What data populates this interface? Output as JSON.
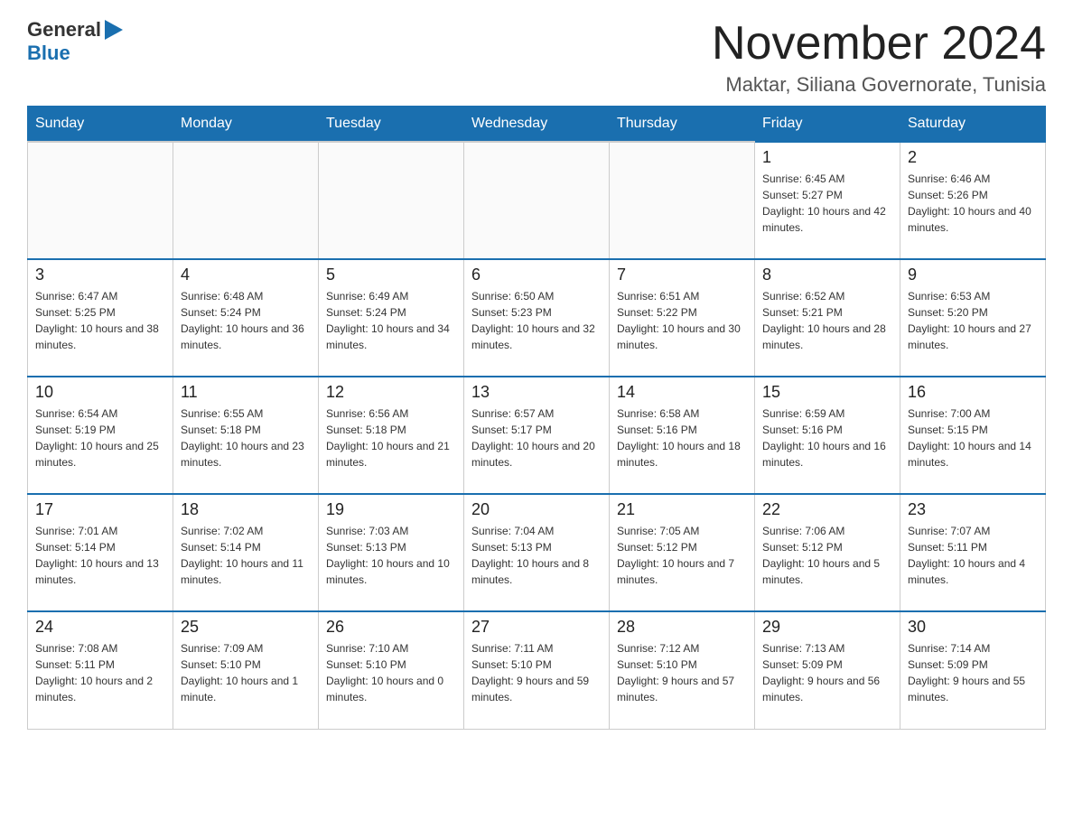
{
  "header": {
    "logo": {
      "general": "General",
      "blue": "Blue"
    },
    "title": "November 2024",
    "subtitle": "Maktar, Siliana Governorate, Tunisia"
  },
  "days_of_week": [
    "Sunday",
    "Monday",
    "Tuesday",
    "Wednesday",
    "Thursday",
    "Friday",
    "Saturday"
  ],
  "weeks": [
    {
      "days": [
        {
          "number": "",
          "info": ""
        },
        {
          "number": "",
          "info": ""
        },
        {
          "number": "",
          "info": ""
        },
        {
          "number": "",
          "info": ""
        },
        {
          "number": "",
          "info": ""
        },
        {
          "number": "1",
          "info": "Sunrise: 6:45 AM\nSunset: 5:27 PM\nDaylight: 10 hours and 42 minutes."
        },
        {
          "number": "2",
          "info": "Sunrise: 6:46 AM\nSunset: 5:26 PM\nDaylight: 10 hours and 40 minutes."
        }
      ]
    },
    {
      "days": [
        {
          "number": "3",
          "info": "Sunrise: 6:47 AM\nSunset: 5:25 PM\nDaylight: 10 hours and 38 minutes."
        },
        {
          "number": "4",
          "info": "Sunrise: 6:48 AM\nSunset: 5:24 PM\nDaylight: 10 hours and 36 minutes."
        },
        {
          "number": "5",
          "info": "Sunrise: 6:49 AM\nSunset: 5:24 PM\nDaylight: 10 hours and 34 minutes."
        },
        {
          "number": "6",
          "info": "Sunrise: 6:50 AM\nSunset: 5:23 PM\nDaylight: 10 hours and 32 minutes."
        },
        {
          "number": "7",
          "info": "Sunrise: 6:51 AM\nSunset: 5:22 PM\nDaylight: 10 hours and 30 minutes."
        },
        {
          "number": "8",
          "info": "Sunrise: 6:52 AM\nSunset: 5:21 PM\nDaylight: 10 hours and 28 minutes."
        },
        {
          "number": "9",
          "info": "Sunrise: 6:53 AM\nSunset: 5:20 PM\nDaylight: 10 hours and 27 minutes."
        }
      ]
    },
    {
      "days": [
        {
          "number": "10",
          "info": "Sunrise: 6:54 AM\nSunset: 5:19 PM\nDaylight: 10 hours and 25 minutes."
        },
        {
          "number": "11",
          "info": "Sunrise: 6:55 AM\nSunset: 5:18 PM\nDaylight: 10 hours and 23 minutes."
        },
        {
          "number": "12",
          "info": "Sunrise: 6:56 AM\nSunset: 5:18 PM\nDaylight: 10 hours and 21 minutes."
        },
        {
          "number": "13",
          "info": "Sunrise: 6:57 AM\nSunset: 5:17 PM\nDaylight: 10 hours and 20 minutes."
        },
        {
          "number": "14",
          "info": "Sunrise: 6:58 AM\nSunset: 5:16 PM\nDaylight: 10 hours and 18 minutes."
        },
        {
          "number": "15",
          "info": "Sunrise: 6:59 AM\nSunset: 5:16 PM\nDaylight: 10 hours and 16 minutes."
        },
        {
          "number": "16",
          "info": "Sunrise: 7:00 AM\nSunset: 5:15 PM\nDaylight: 10 hours and 14 minutes."
        }
      ]
    },
    {
      "days": [
        {
          "number": "17",
          "info": "Sunrise: 7:01 AM\nSunset: 5:14 PM\nDaylight: 10 hours and 13 minutes."
        },
        {
          "number": "18",
          "info": "Sunrise: 7:02 AM\nSunset: 5:14 PM\nDaylight: 10 hours and 11 minutes."
        },
        {
          "number": "19",
          "info": "Sunrise: 7:03 AM\nSunset: 5:13 PM\nDaylight: 10 hours and 10 minutes."
        },
        {
          "number": "20",
          "info": "Sunrise: 7:04 AM\nSunset: 5:13 PM\nDaylight: 10 hours and 8 minutes."
        },
        {
          "number": "21",
          "info": "Sunrise: 7:05 AM\nSunset: 5:12 PM\nDaylight: 10 hours and 7 minutes."
        },
        {
          "number": "22",
          "info": "Sunrise: 7:06 AM\nSunset: 5:12 PM\nDaylight: 10 hours and 5 minutes."
        },
        {
          "number": "23",
          "info": "Sunrise: 7:07 AM\nSunset: 5:11 PM\nDaylight: 10 hours and 4 minutes."
        }
      ]
    },
    {
      "days": [
        {
          "number": "24",
          "info": "Sunrise: 7:08 AM\nSunset: 5:11 PM\nDaylight: 10 hours and 2 minutes."
        },
        {
          "number": "25",
          "info": "Sunrise: 7:09 AM\nSunset: 5:10 PM\nDaylight: 10 hours and 1 minute."
        },
        {
          "number": "26",
          "info": "Sunrise: 7:10 AM\nSunset: 5:10 PM\nDaylight: 10 hours and 0 minutes."
        },
        {
          "number": "27",
          "info": "Sunrise: 7:11 AM\nSunset: 5:10 PM\nDaylight: 9 hours and 59 minutes."
        },
        {
          "number": "28",
          "info": "Sunrise: 7:12 AM\nSunset: 5:10 PM\nDaylight: 9 hours and 57 minutes."
        },
        {
          "number": "29",
          "info": "Sunrise: 7:13 AM\nSunset: 5:09 PM\nDaylight: 9 hours and 56 minutes."
        },
        {
          "number": "30",
          "info": "Sunrise: 7:14 AM\nSunset: 5:09 PM\nDaylight: 9 hours and 55 minutes."
        }
      ]
    }
  ]
}
